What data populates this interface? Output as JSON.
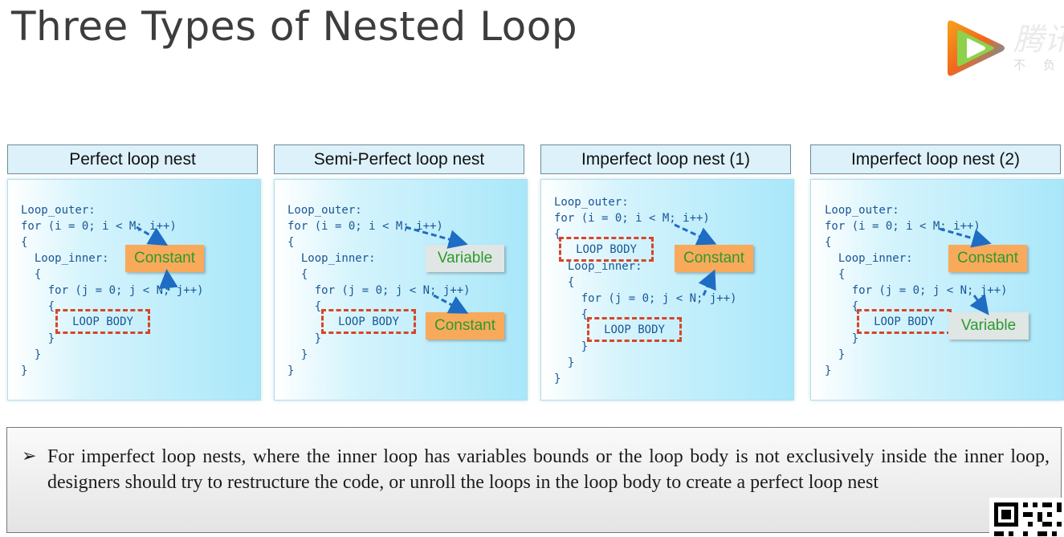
{
  "slide": {
    "title": "Three Types of Nested Loop"
  },
  "watermark": {
    "brand_text": "腾讯",
    "sub_text": "不负"
  },
  "panels": [
    {
      "heading": "Perfect loop nest",
      "code_lines": [
        "Loop_outer:",
        "for (i = 0; i < M; i++)",
        "{",
        "  Loop_inner:",
        "  {",
        "    for (j = 0; j < N; j++)",
        "    {",
        "",
        "    }",
        "  }",
        "}"
      ],
      "loop_body": "LOOP BODY",
      "tags": [
        "Constant"
      ]
    },
    {
      "heading": "Semi-Perfect loop nest",
      "code_lines": [
        "Loop_outer:",
        "for (i = 0; i < M; i++)",
        "{",
        "  Loop_inner:",
        "  {",
        "    for (j = 0; j < N; j++)",
        "    {",
        "",
        "    }",
        "  }",
        "}"
      ],
      "loop_body": "LOOP BODY",
      "tags": [
        "Variable",
        "Constant"
      ]
    },
    {
      "heading": "Imperfect loop nest (1)",
      "code_lines": [
        "Loop_outer:",
        "for (i = 0; i < M; i++)",
        "{",
        "",
        "  Loop_inner:",
        "  {",
        "    for (j = 0; j < N; j++)",
        "    {",
        "",
        "    }",
        "  }",
        "}"
      ],
      "loop_body": "LOOP BODY",
      "tags": [
        "Constant"
      ]
    },
    {
      "heading": "Imperfect loop nest (2)",
      "code_lines": [
        "Loop_outer:",
        "for (i = 0; i < M; i++)",
        "{",
        "  Loop_inner:",
        "  {",
        "    for (j = 0; j < N; j++)",
        "    {",
        "",
        "    }",
        "  }",
        "}"
      ],
      "loop_body": "LOOP BODY",
      "tags": [
        "Constant",
        "Variable"
      ]
    }
  ],
  "note": {
    "bullet": "➢",
    "text": "For imperfect loop nests, where the inner loop has variables bounds or the loop body is not exclusively inside the inner loop, designers should try to restructure the code, or unroll the loops in the loop body to create a perfect loop nest"
  },
  "colors": {
    "title": "#3d3d3d",
    "code": "#1a5696",
    "dash_border": "#d6452a",
    "constant_fill": "#f8aa5a",
    "variable_fill": "#dfe6e4",
    "tag_text": "#2e9a2e",
    "panel_gradient_end": "#a8e7fa"
  }
}
